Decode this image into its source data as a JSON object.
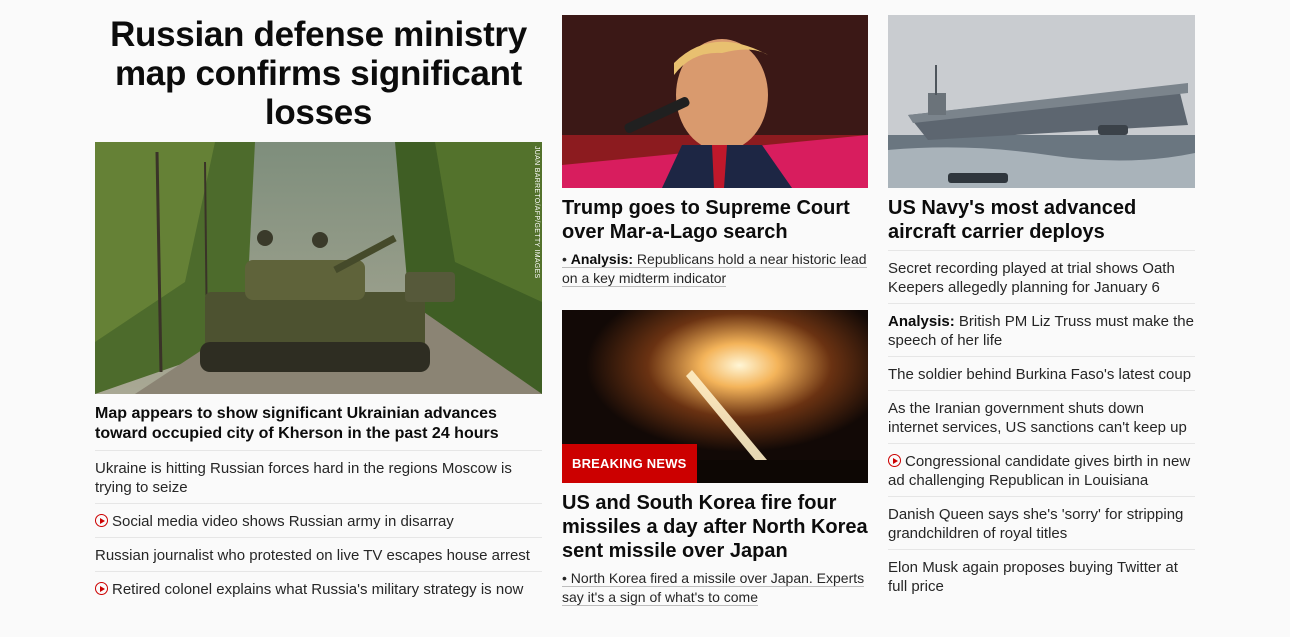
{
  "col1": {
    "title": "Russian defense ministry map confirms significant losses",
    "photo_credit": "JUAN BARRETO/AFP/GETTY IMAGES",
    "headline": "Map appears to show significant Ukrainian advances toward occupied city of Kherson in the past 24 hours",
    "items": [
      {
        "text": "Ukraine is hitting Russian forces hard in the regions Moscow is trying to seize",
        "video": false
      },
      {
        "text": "Social media video shows Russian army in disarray",
        "video": true
      },
      {
        "text": "Russian journalist who protested on live TV escapes house arrest",
        "video": false
      },
      {
        "text": "Retired colonel explains what Russia's military strategy is now",
        "video": true
      }
    ]
  },
  "col2": {
    "story1": {
      "headline": "Trump goes to Supreme Court over Mar-a-Lago search",
      "bullet": "• ",
      "analysis_label": "Analysis:",
      "sub": " Republicans hold a near historic lead on a key midterm indicator"
    },
    "story2": {
      "badge": "BREAKING NEWS",
      "headline": "US and South Korea fire four missiles a day after North Korea sent missile over Japan",
      "sub": "• North Korea fired a missile over Japan. Experts say it's a sign of what's to come"
    }
  },
  "col3": {
    "headline": "US Navy's most advanced aircraft carrier deploys",
    "items": [
      {
        "analysis": "",
        "text": "Secret recording played at trial shows Oath Keepers allegedly planning for January 6",
        "video": false
      },
      {
        "analysis": "Analysis:",
        "text": " British PM Liz Truss must make the speech of her life",
        "video": false
      },
      {
        "analysis": "",
        "text": "The soldier behind Burkina Faso's latest coup",
        "video": false
      },
      {
        "analysis": "",
        "text": "As the Iranian government shuts down internet services, US sanctions can't keep up",
        "video": false
      },
      {
        "analysis": "",
        "text": "Congressional candidate gives birth in new ad challenging Republican in Louisiana",
        "video": true
      },
      {
        "analysis": "",
        "text": "Danish Queen says she's 'sorry' for stripping grandchildren of royal titles",
        "video": false
      },
      {
        "analysis": "",
        "text": "Elon Musk again proposes buying Twitter at full price",
        "video": false
      }
    ]
  },
  "colors": {
    "brand_red": "#cc0000",
    "text": "#0c0c0c"
  }
}
